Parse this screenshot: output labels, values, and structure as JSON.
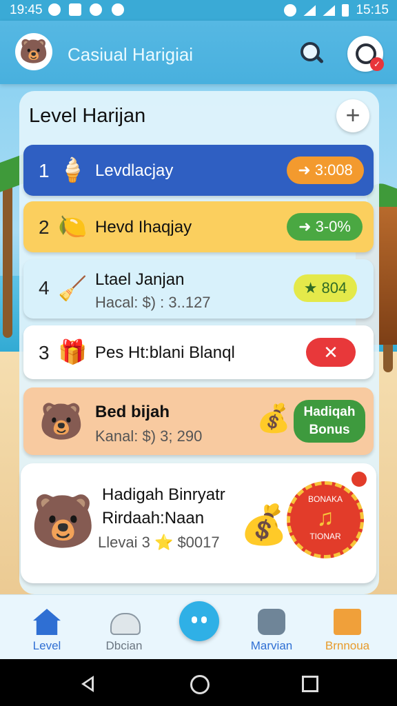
{
  "status_bar": {
    "time_left": "19:45",
    "time_right": "15:15"
  },
  "app_bar": {
    "title": "Casiual Harigiai",
    "avatar_icon": "bear-avatar-icon",
    "search_icon": "search-icon",
    "profile_icon": "profile-icon",
    "profile_badge": "✓"
  },
  "panel": {
    "title": "Level Harijan",
    "add_icon": "plus-icon",
    "add_glyph": "+"
  },
  "levels": [
    {
      "number": "1",
      "label": "Levdlacjay",
      "icon": "🍦",
      "reward": "➜ 3:008",
      "reward_color": "#f39a2e"
    },
    {
      "number": "2",
      "label": "Hevd Ihaqjay",
      "icon": "🍋",
      "reward": "➜ 3-0%",
      "reward_color": "#4aa842"
    },
    {
      "number": "4",
      "label": "Ltael Janjan",
      "sub": "Hacal: $) : 3..127",
      "icon": "🧹",
      "reward": "★ 804",
      "reward_color": "#e4e94a"
    },
    {
      "number": "3",
      "label": "Pes Ht:blani Blanql",
      "icon": "🎁",
      "reward": "✕",
      "reward_color": "#e8383a"
    },
    {
      "label": "Bed bijah",
      "sub": "Kanal: $) 3; 290",
      "icon": "🐻",
      "reward": "Hadiqah Bonus",
      "reward_color": "#3e9a3e",
      "extra_icon": "💰"
    }
  ],
  "promo": {
    "title_line1": "Hadigah Binryatr",
    "title_line2": "Rirdaah:Naan",
    "sub": "Llevai 3 ⭐ $0017",
    "bear_icon": "🐻",
    "coin_icon": "💰",
    "badge_top": "BONAKA",
    "badge_mid": "♫",
    "badge_bottom": "TIONAR"
  },
  "bottom_nav": [
    {
      "label": "Level",
      "color": "#2f6fd3"
    },
    {
      "label": "Dbcian",
      "color": "#6a7580"
    },
    {
      "label": "Marvian",
      "color": "#2f6fd3"
    },
    {
      "label": "Brnnoua",
      "color": "#e89a2a"
    }
  ]
}
